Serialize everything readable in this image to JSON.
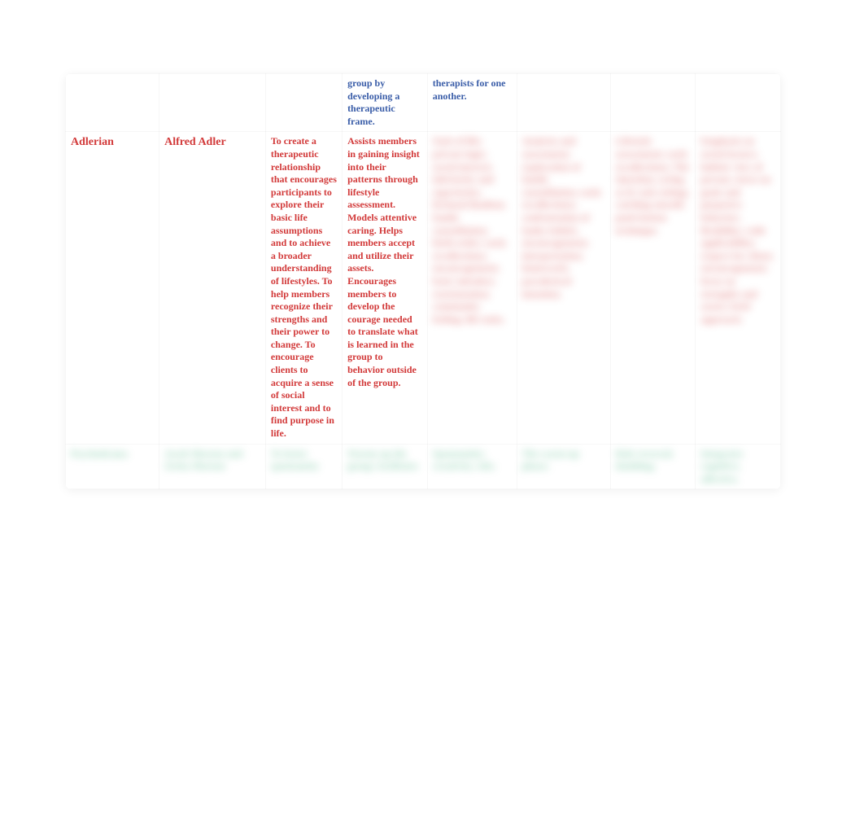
{
  "rows": {
    "prev": {
      "col4": "group by developing a therapeutic frame.",
      "col5": "therapists for one another."
    },
    "adlerian": {
      "col1": "Adlerian",
      "col2": "Alfred Adler",
      "col3": "To create a therapeutic relationship that encourages participants to explore their basic life assumptions and to achieve a broader understanding of lifestyles. To help members recognize their strengths and their power to change. To encourage clients to acquire a sense of social interest and to find purpose in life.",
      "col4": "Assists members in gaining insight into their patterns through lifestyle assessment. Models attentive caring. Helps members accept and utilize their assets. Encourages members to develop the courage needed to translate what is learned in the group to behavior outside of the group.",
      "col5_blur": "Style of life; private logic; social interest; inferiority and superiority; fictional finalism; family constellation; birth order; early recollections; encouragement; basic mistakes; reorientation; community feeling; life tasks.",
      "col6_blur": "Analysis and assessment; exploration of family constellation; early recollections; confrontation of faulty beliefs; encouragement; interpretation; homework; paradoxical intention.",
      "col7_blur": "Lifestyle assessment; early recollections; The Question; acting as if; task setting; catching oneself; push-button technique.",
      "col8_blur": "Emphasis on social factors; holistic view of person; stress on goals and purposive behavior; flexibility; wide applicability; respect for client; encouragement; focus on strengths and assets; brief approach."
    },
    "next": {
      "col1_blur": "Psychodrama",
      "col2_blur": "Jacob Moreno and Zerka Moreno",
      "col3_blur": "To foster spontaneity",
      "col4_blur": "Warms up the group; facilitates",
      "col5_blur": "Spontaneity; creativity; tele;",
      "col6_blur": "The warm-up phase;",
      "col7_blur": "Role reversal; doubling;",
      "col8_blur": "Integrates cognitive, affective,"
    }
  }
}
